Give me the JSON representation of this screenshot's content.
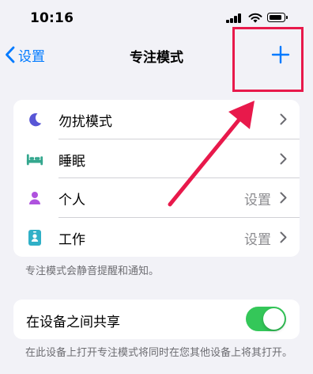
{
  "status_bar": {
    "time": "10:16"
  },
  "nav": {
    "back_label": "设置",
    "title": "专注模式",
    "add_icon": "plus-icon"
  },
  "focus_modes": [
    {
      "label": "勿扰模式",
      "icon": "moon-icon",
      "color": "#5856d6",
      "value": ""
    },
    {
      "label": "睡眠",
      "icon": "bed-icon",
      "color": "#34a78e",
      "value": ""
    },
    {
      "label": "个人",
      "icon": "person-icon",
      "color": "#af52de",
      "value": "设置"
    },
    {
      "label": "工作",
      "icon": "work-badge-icon",
      "color": "#30b0c7",
      "value": "设置"
    }
  ],
  "focus_footer": "专注模式会静音提醒和通知。",
  "share": {
    "label": "在设备之间共享",
    "enabled": true,
    "footer": "在此设备上打开专注模式将同时在您其他设备上将其打开。"
  },
  "colors": {
    "accent": "#007aff",
    "toggle_on": "#34c759",
    "highlight": "#e8194b"
  }
}
